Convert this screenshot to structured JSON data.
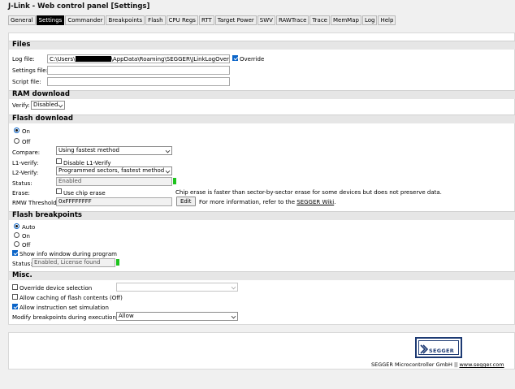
{
  "window": {
    "title": "J-Link - Web control panel [Settings]"
  },
  "tabs": [
    "General",
    "Settings",
    "Commander",
    "Breakpoints",
    "Flash",
    "CPU Regs",
    "RTT",
    "Target Power",
    "SWV",
    "RAWTrace",
    "Trace",
    "MemMap",
    "Log",
    "Help"
  ],
  "active_tab": "Settings",
  "files": {
    "heading": "Files",
    "log_file_label": "Log file:",
    "log_file_prefix": "C:\\Users\\",
    "log_file_suffix": "\\AppData\\Roaming\\SEGGER\\JLinkLogOverri",
    "override_label": "Override",
    "override_checked": true,
    "settings_file_label": "Settings file:",
    "settings_file_value": "",
    "script_file_label": "Script file:",
    "script_file_value": ""
  },
  "ram_download": {
    "heading": "RAM download",
    "verify_label": "Verify:",
    "verify_value": "Disabled"
  },
  "flash_download": {
    "heading": "Flash download",
    "on_label": "On",
    "off_label": "Off",
    "selected": "On",
    "compare_label": "Compare:",
    "compare_value": "Using fastest method",
    "l1_verify_label": "L1-verify:",
    "l1_verify_cb_label": "Disable L1-Verify",
    "l1_verify_checked": false,
    "l2_verify_label": "L2-Verify:",
    "l2_verify_value": "Programmed sectors, fastest method",
    "status_label": "Status:",
    "status_value": "Enabled",
    "erase_label": "Erase:",
    "erase_cb_label": "Use chip erase",
    "erase_checked": false,
    "erase_note": "Chip erase is faster than sector-by-sector erase for some devices but does not preserve data.",
    "rmw_label": "RMW Threshold:",
    "rmw_value": "0xFFFFFFFF",
    "edit_label": "Edit",
    "info_prefix": "For more information, refer to the",
    "info_link": "SEGGER Wiki",
    "info_suffix": "."
  },
  "flash_breakpoints": {
    "heading": "Flash breakpoints",
    "auto_label": "Auto",
    "on_label": "On",
    "off_label": "Off",
    "selected": "Auto",
    "show_info_label": "Show info window during program",
    "show_info_checked": true,
    "status_label": "Status:",
    "status_value": "Enabled, License found"
  },
  "misc": {
    "heading": "Misc.",
    "override_device_label": "Override device selection",
    "override_device_checked": false,
    "override_device_value": "",
    "allow_caching_label": "Allow caching of flash contents (Off)",
    "allow_caching_checked": false,
    "allow_sim_label": "Allow instruction set simulation",
    "allow_sim_checked": true,
    "modify_bp_label": "Modify breakpoints during execution:",
    "modify_bp_value": "Allow"
  },
  "footer": {
    "logo_text": "SEGGER",
    "company": "SEGGER Microcontroller GmbH ||",
    "url": "www.segger.com"
  },
  "colors": {
    "status_ok": "#1ec31e",
    "logo": "#1d3a73",
    "checkbox_on": "#0a64c8"
  }
}
